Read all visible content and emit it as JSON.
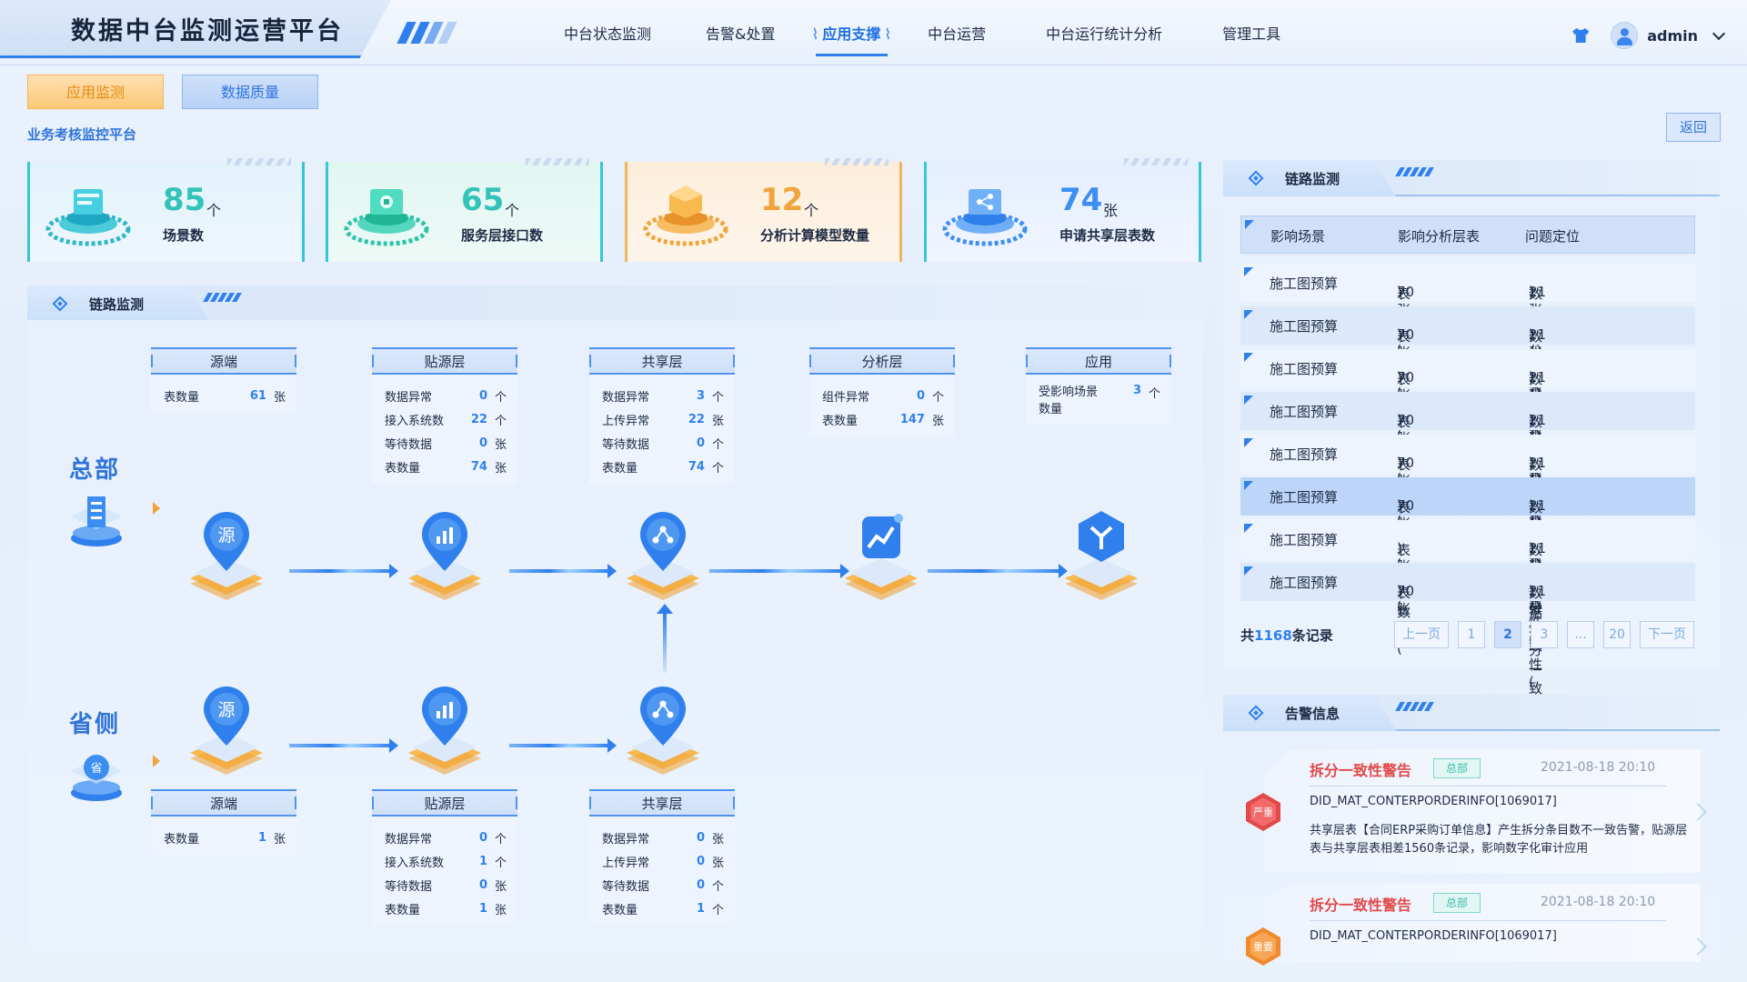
{
  "header": {
    "app_title": "数据中台监测运营平台",
    "nav": [
      "中台状态监测",
      "告警&处置",
      "应用支撑",
      "中台运营",
      "中台运行统计分析",
      "管理工具"
    ],
    "active_nav": "应用支撑",
    "username": "admin",
    "icons": {
      "shirt": "shirt-icon",
      "avatar": "user-avatar-icon",
      "dropdown": "chevron-down-icon"
    }
  },
  "tabs": {
    "app_monitor": "应用监测",
    "data_quality": "数据质量"
  },
  "subtitle": "业务考核监控平台",
  "back_label": "返回",
  "stats": [
    {
      "value": "85",
      "unit": "个",
      "label": "场景数",
      "icon": "scene-platform-icon"
    },
    {
      "value": "65",
      "unit": "个",
      "label": "服务层接口数",
      "icon": "service-platform-icon"
    },
    {
      "value": "12",
      "unit": "个",
      "label": "分析计算模型数量",
      "icon": "model-platform-icon"
    },
    {
      "value": "74",
      "unit": "张",
      "label": "申请共享层表数",
      "icon": "share-platform-icon"
    }
  ],
  "chain_section": {
    "title": "链路监测"
  },
  "regions": {
    "hq": "总部",
    "province": "省侧"
  },
  "node_glyphs": {
    "source": "源",
    "hq_building": "building-icon",
    "province": "省"
  },
  "hq_layers": [
    {
      "title": "源端",
      "rows": [
        {
          "k": "表数量",
          "v": "61",
          "u": "张"
        }
      ]
    },
    {
      "title": "贴源层",
      "rows": [
        {
          "k": "数据异常",
          "v": "0",
          "u": "个"
        },
        {
          "k": "接入系统数",
          "v": "22",
          "u": "个"
        },
        {
          "k": "等待数据",
          "v": "0",
          "u": "张"
        },
        {
          "k": "表数量",
          "v": "74",
          "u": "张"
        }
      ]
    },
    {
      "title": "共享层",
      "rows": [
        {
          "k": "数据异常",
          "v": "3",
          "u": "个"
        },
        {
          "k": "上传异常",
          "v": "22",
          "u": "张"
        },
        {
          "k": "等待数据",
          "v": "0",
          "u": "个"
        },
        {
          "k": "表数量",
          "v": "74",
          "u": "个"
        }
      ]
    },
    {
      "title": "分析层",
      "rows": [
        {
          "k": "组件异常",
          "v": "0",
          "u": "个"
        },
        {
          "k": "表数量",
          "v": "147",
          "u": "张"
        }
      ]
    },
    {
      "title": "应用",
      "rows": [
        {
          "k": "受影响场景\n数量",
          "v": "3",
          "u": "个"
        }
      ]
    }
  ],
  "prov_layers": [
    {
      "title": "源端",
      "rows": [
        {
          "k": "表数量",
          "v": "1",
          "u": "张"
        }
      ]
    },
    {
      "title": "贴源层",
      "rows": [
        {
          "k": "数据异常",
          "v": "0",
          "u": "个"
        },
        {
          "k": "接入系统数",
          "v": "1",
          "u": "个"
        },
        {
          "k": "等待数据",
          "v": "0",
          "u": "张"
        },
        {
          "k": "表数量",
          "v": "1",
          "u": "张"
        }
      ]
    },
    {
      "title": "共享层",
      "rows": [
        {
          "k": "数据异常",
          "v": "0",
          "u": "张"
        },
        {
          "k": "上传异常",
          "v": "0",
          "u": "张"
        },
        {
          "k": "等待数据",
          "v": "0",
          "u": "个"
        },
        {
          "k": "表数量",
          "v": "1",
          "u": "个"
        }
      ]
    }
  ],
  "right_chain": {
    "title": "链路监测",
    "columns": [
      "影响场景",
      "影响分析层表",
      "问题定位"
    ],
    "rows": [
      {
        "scene": "施工图预算",
        "tbl_pre": "表数量(",
        "tbl_num": "70",
        "tbl_post": ")张",
        "loc_pre": "数据拆分一致性(",
        "loc_num": "21",
        "loc_post": ")张"
      },
      {
        "scene": "施工图预算",
        "tbl_pre": "表数量(",
        "tbl_num": "70",
        "tbl_post": ")张",
        "loc_pre": "数据拆分一致性(",
        "loc_num": "21",
        "loc_post": ")张"
      },
      {
        "scene": "施工图预算",
        "tbl_pre": "表数量(",
        "tbl_num": "70",
        "tbl_post": ")张",
        "loc_pre": "数据拆分一致性(",
        "loc_num": "21",
        "loc_post": ")张"
      },
      {
        "scene": "施工图预算",
        "tbl_pre": "表数量(",
        "tbl_num": "70",
        "tbl_post": ")张",
        "loc_pre": "数据拆分一致性(",
        "loc_num": "21",
        "loc_post": ")张"
      },
      {
        "scene": "施工图预算",
        "tbl_pre": "表数量(",
        "tbl_num": "70",
        "tbl_post": ")张",
        "loc_pre": "数据拆分一致性(",
        "loc_num": "21",
        "loc_post": ")张"
      },
      {
        "scene": "施工图预算",
        "tbl_pre": "表数量(",
        "tbl_num": "70",
        "tbl_post": ")张",
        "loc_pre": "数据拆分一致性(",
        "loc_num": "21",
        "loc_post": ")张"
      },
      {
        "scene": "施工图预算",
        "tbl_pre": "表数量(",
        "tbl_num": "",
        "tbl_post": ")张",
        "loc_pre": "数据拆分一致性(",
        "loc_num": "21",
        "loc_post": ")张"
      },
      {
        "scene": "施工图预算",
        "tbl_pre": "表数量(",
        "tbl_num": "70",
        "tbl_post": ")张",
        "loc_pre": "数据拆分一致性(",
        "loc_num": "21",
        "loc_post": ")张"
      }
    ],
    "selected_row": 6,
    "pager": {
      "total_pre": "共",
      "total_num": "1168",
      "total_post": "条记录",
      "prev": "上一页",
      "next": "下一页",
      "pages": [
        "1",
        "2",
        "3",
        "...",
        "20"
      ],
      "current": "2"
    }
  },
  "alerts": {
    "title": "告警信息",
    "items": [
      {
        "title": "拆分一致性警告",
        "tag": "总部",
        "time": "2021-08-18  20:10",
        "code": "DID_MAT_CONTERPORDERINFO[1069017]",
        "desc": "共享层表【合同ERP采购订单信息】产生拆分条目数不一致告警，贴源层表与共享层表相差1560条记录，影响数字化审计应用",
        "level": "严重",
        "level_color": "#e14a4a"
      },
      {
        "title": "拆分一致性警告",
        "tag": "总部",
        "time": "2021-08-18  20:10",
        "code": "DID_MAT_CONTERPORDERINFO[1069017]",
        "desc": "",
        "level": "重要",
        "level_color": "#f08a2c"
      }
    ]
  },
  "colors": {
    "accent": "#2f80ed",
    "teal": "#33c3b8",
    "orange": "#f1a43c",
    "danger": "#e14a4a"
  }
}
